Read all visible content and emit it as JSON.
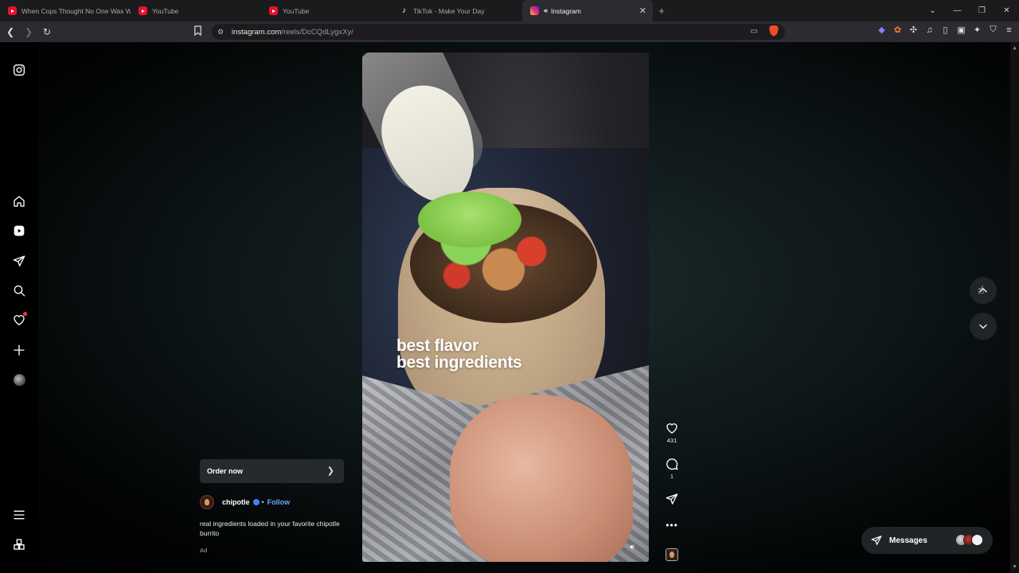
{
  "browser": {
    "tabs": [
      {
        "title": "When Cops Thought No One Was W",
        "favicon": "youtube-icon",
        "active": false
      },
      {
        "title": "YouTube",
        "favicon": "youtube-icon",
        "active": false
      },
      {
        "title": "YouTube",
        "favicon": "youtube-icon",
        "active": false
      },
      {
        "title": "TikTok - Make Your Day",
        "favicon": "tiktok-icon",
        "active": false
      },
      {
        "title": "Instagram",
        "favicon": "instagram-icon",
        "active": true
      }
    ],
    "new_tab_label": "+",
    "url_domain": "instagram.com",
    "url_path": "/reels/DcCQdLygxXy/"
  },
  "sidebar": {
    "items": [
      "instagram-logo-icon",
      "home-icon",
      "reels-icon",
      "messages-icon",
      "search-icon",
      "notifications-icon",
      "create-icon",
      "profile-icon",
      "menu-icon",
      "more-icon"
    ]
  },
  "reel": {
    "video_caption_line1": "best flavor",
    "video_caption_line2": "best ingredients",
    "order_label": "Order now",
    "author": "chipotle",
    "separator": "•",
    "follow_label": "Follow",
    "caption": "real ingredients loaded in your favorite chipotle burrito",
    "ad_label": "Ad",
    "likes": "431",
    "comments": "1",
    "more_label": "•••"
  },
  "messages": {
    "label": "Messages"
  },
  "colors": {
    "accent_follow": "#6aa6ff",
    "verified": "#3b82f6",
    "notification": "#ff3040"
  }
}
